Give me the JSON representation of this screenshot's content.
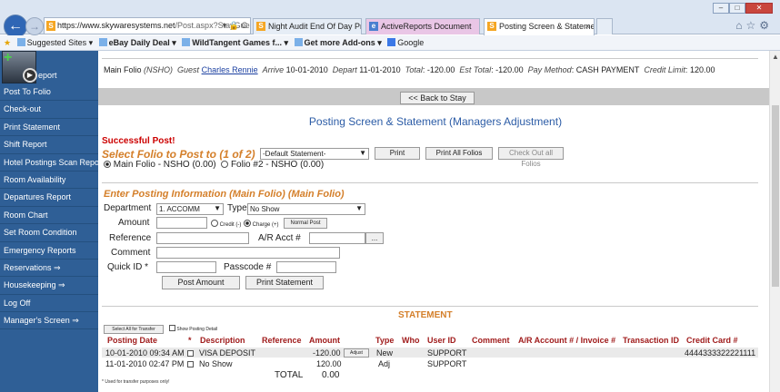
{
  "browser": {
    "url_host": "https://www.skywaresystems.net",
    "url_path": "/Post.aspx?StayGuest",
    "tabs": [
      {
        "label": "Night Audit End Of Day Process"
      },
      {
        "label": "ActiveReports Document"
      },
      {
        "label": "Posting Screen & Statemen..."
      }
    ],
    "favorites": [
      {
        "label": "Suggested Sites ▾"
      },
      {
        "label": "eBay Daily Deal ▾"
      },
      {
        "label": "WildTangent Games f... ▾"
      },
      {
        "label": "Get more Add-ons ▾"
      },
      {
        "label": "Google"
      }
    ]
  },
  "sidebar": {
    "logo_label": "eport",
    "items": [
      {
        "label": "Post To Folio"
      },
      {
        "label": "Check-out"
      },
      {
        "label": "Print Statement"
      },
      {
        "label": "Shift Report"
      },
      {
        "label": "Hotel Postings Scan Report"
      },
      {
        "label": "Room Availability"
      },
      {
        "label": "Departures Report"
      },
      {
        "label": "Room Chart"
      },
      {
        "label": "Set Room Condition"
      },
      {
        "label": "Emergency Reports"
      },
      {
        "label": "Reservations ⇒"
      },
      {
        "label": "Housekeeping ⇒"
      },
      {
        "label": "Log Off"
      },
      {
        "label": "Manager's Screen ⇒"
      }
    ]
  },
  "info": {
    "folio_label": "Main Folio",
    "folio_code": "(NSHO)",
    "guest_label": "Guest",
    "guest_name": "Charles Rennie",
    "arrive_label": "Arrive",
    "arrive": "10-01-2010",
    "depart_label": "Depart",
    "depart": "11-01-2010",
    "total_label": "Total",
    "total": "-120.00",
    "est_total_label": "Est Total",
    "est_total": "-120.00",
    "pay_method_label": "Pay Method",
    "pay_method": "CASH PAYMENT",
    "credit_limit_label": "Credit Limit",
    "credit_limit": "120.00"
  },
  "back_button": "<< Back to Stay",
  "page_title": "Posting Screen & Statement (Managers Adjustment)",
  "success_message": "Successful Post!",
  "select_folio": {
    "title": "Select Folio to Post to (1 of 2)",
    "selected": "-Default Statement-",
    "print_btn": "Print",
    "print_all_btn": "Print All Folios",
    "checkout_all_btn": "Check Out all Folios",
    "folio_options": [
      {
        "label": "Main Folio - NSHO (0.00)",
        "selected": true
      },
      {
        "label": "Folio #2 - NSHO (0.00)",
        "selected": false
      }
    ]
  },
  "posting": {
    "title": "Enter Posting Information (Main Folio) (Main Folio)",
    "department_label": "Department",
    "department_value": "1. ACCOMM",
    "type_label": "Type",
    "type_value": "No Show",
    "amount_label": "Amount",
    "credit_label": "Credit (-)",
    "charge_label": "Charge (+)",
    "normal_post_btn": "Normal Post",
    "reference_label": "Reference",
    "ar_acct_label": "A/R Acct #",
    "ar_lookup_btn": "...",
    "comment_label": "Comment",
    "quick_id_label": "Quick ID *",
    "passcode_label": "Passcode #",
    "post_amount_btn": "Post Amount",
    "print_statement_btn": "Print Statement"
  },
  "statement": {
    "title": "STATEMENT",
    "select_all_btn": "Select All for Transfer",
    "show_posting_detail": "Show Posting Detail",
    "columns": [
      "Posting Date",
      "*",
      "Description",
      "Reference",
      "Amount",
      "Type",
      "Who",
      "User ID",
      "Comment",
      "A/R Account # / Invoice #",
      "Transaction ID",
      "Credit Card #"
    ],
    "rows": [
      {
        "date": "10-01-2010 09:34 AM",
        "description": "VISA DEPOSIT",
        "amount": "-120.00",
        "adjust": "Adjust",
        "type": "New",
        "user": "SUPPORT",
        "card": "4444333322221111"
      },
      {
        "date": "11-01-2010 02:47 PM",
        "description": "No Show",
        "amount": "120.00",
        "adjust": "",
        "type": "Adj",
        "user": "SUPPORT",
        "card": ""
      }
    ],
    "total_label": "TOTAL",
    "total_value": "0.00",
    "footnote": "* Used for transfer purposes only!"
  }
}
